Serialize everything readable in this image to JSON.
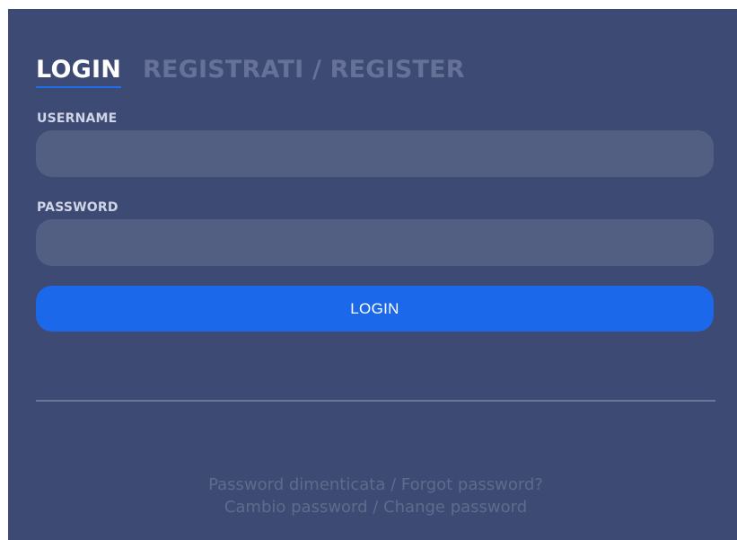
{
  "tabs": {
    "login_label": "LOGIN",
    "register_label": "REGISTRATI / REGISTER",
    "active": "LOGIN"
  },
  "form": {
    "username_label": "USERNAME",
    "username_value": "",
    "password_label": "PASSWORD",
    "password_value": "",
    "login_button_label": "LOGIN"
  },
  "links": {
    "forgot_password": "Password dimenticata / Forgot password?",
    "change_password": "Cambio password / Change password"
  },
  "colors": {
    "panel_background": "#3d4b74",
    "input_background": "#525f82",
    "accent": "#1c68ea",
    "active_tab_text": "#ffffff",
    "inactive_tab_text": "#667197",
    "link_text": "#5f6a8c"
  }
}
